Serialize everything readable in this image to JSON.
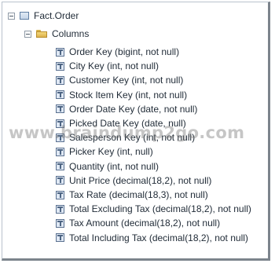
{
  "tree": {
    "root": {
      "label": "Fact.Order",
      "expander": "collapse-toggle",
      "icon": "table-icon"
    },
    "folder": {
      "label": "Columns",
      "expander": "collapse-toggle",
      "icon": "folder-icon"
    },
    "columns": [
      {
        "label": "Order Key (bigint, not null)",
        "icon": "column-icon"
      },
      {
        "label": "City Key (int, not null)",
        "icon": "column-icon"
      },
      {
        "label": "Customer Key (int, not null)",
        "icon": "column-icon"
      },
      {
        "label": "Stock Item Key (int, not null)",
        "icon": "column-icon"
      },
      {
        "label": "Order Date Key (date, not null)",
        "icon": "column-icon"
      },
      {
        "label": "Picked Date Key (date, null)",
        "icon": "column-icon"
      },
      {
        "label": "Salesperson Key (int, not null)",
        "icon": "column-icon"
      },
      {
        "label": "Picker Key (int, null)",
        "icon": "column-icon"
      },
      {
        "label": "Quantity (int, not null)",
        "icon": "column-icon"
      },
      {
        "label": "Unit Price (decimal(18,2), not null)",
        "icon": "column-icon"
      },
      {
        "label": "Tax Rate (decimal(18,3), not null)",
        "icon": "column-icon"
      },
      {
        "label": "Total Excluding Tax (decimal(18,2), not null)",
        "icon": "column-icon"
      },
      {
        "label": "Tax Amount (decimal(18,2), not null)",
        "icon": "column-icon"
      },
      {
        "label": "Total Including Tax (decimal(18,2), not null)",
        "icon": "column-icon"
      }
    ]
  },
  "watermark": {
    "text": "www.braindump2go.com"
  }
}
